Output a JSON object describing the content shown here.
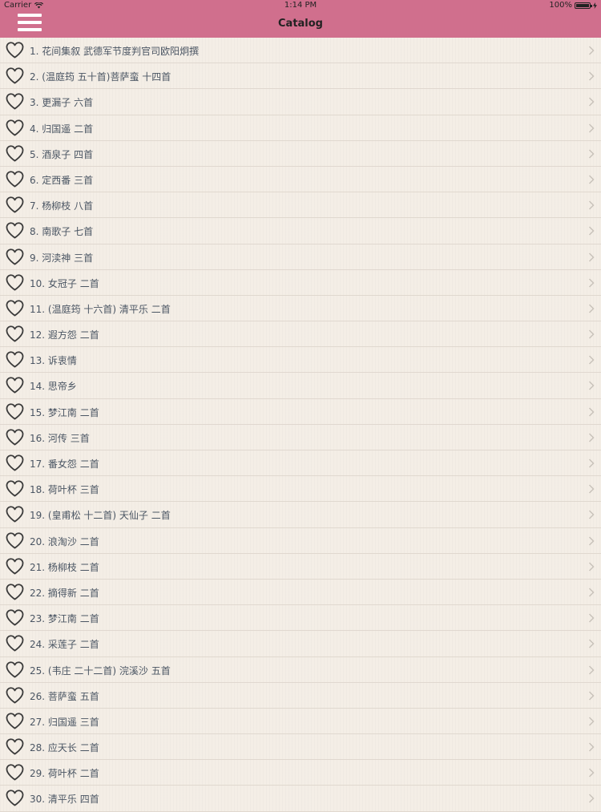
{
  "status_bar": {
    "carrier": "Carrier",
    "time": "1:14 PM",
    "battery": "100%",
    "battery_level": 1.0
  },
  "nav": {
    "title": "Catalog",
    "menu_icon": "hamburger-menu-icon"
  },
  "icons": {
    "favorite": "heart-outline-icon",
    "disclosure": "chevron-right-icon"
  },
  "colors": {
    "nav_background": "#d06f8d",
    "list_background": "#f4eee6",
    "text": "#4a5563",
    "heart_stroke": "#3a3a3a",
    "chevron": "#c9c3bb"
  },
  "items": [
    "1. 花间集叙 武德军节度判官司欧阳炯撰",
    "2. (温庭筠 五十首)菩萨蛮 十四首",
    "3. 更漏子 六首",
    "4. 归国遥 二首",
    "5. 酒泉子 四首",
    "6. 定西番 三首",
    "7. 杨柳枝 八首",
    "8. 南歌子 七首",
    "9. 河渎神 三首",
    "10. 女冠子 二首",
    "11. (温庭筠 十六首) 清平乐 二首",
    "12. 遐方怨 二首",
    "13. 诉衷情",
    "14. 思帝乡",
    "15. 梦江南 二首",
    "16. 河传 三首",
    "17. 番女怨 二首",
    "18. 荷叶杯 三首",
    "19. (皇甫松 十二首) 天仙子 二首",
    "20. 浪淘沙 二首",
    "21. 杨柳枝 二首",
    "22. 摘得新 二首",
    "23. 梦江南 二首",
    "24. 采莲子 二首",
    "25. (韦庄 二十二首) 浣溪沙 五首",
    "26. 菩萨蛮 五首",
    "27. 归国遥 三首",
    "28. 应天长 二首",
    "29. 荷叶杯 二首",
    "30. 清平乐 四首"
  ]
}
